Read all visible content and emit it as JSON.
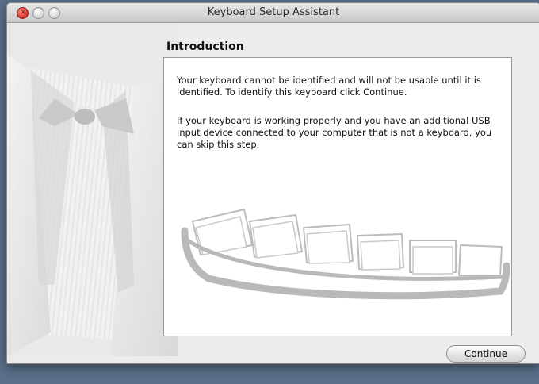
{
  "window": {
    "title": "Keyboard Setup Assistant"
  },
  "page": {
    "heading": "Introduction",
    "paragraphs": [
      "Your keyboard cannot be identified and will not be usable until it is identified. To identify this keyboard click Continue.",
      "If your keyboard is working properly and you have an additional USB input device connected to your computer that is not a keyboard, you can skip this step."
    ]
  },
  "buttons": {
    "continue": "Continue"
  },
  "colors": {
    "close_button": "#e2453b",
    "window_background": "#ececec",
    "desktop": "#5a6f8a"
  },
  "icons": {
    "illustration": "tuxedo-bowtie-illustration",
    "keyboard": "keyboard-illustration"
  }
}
